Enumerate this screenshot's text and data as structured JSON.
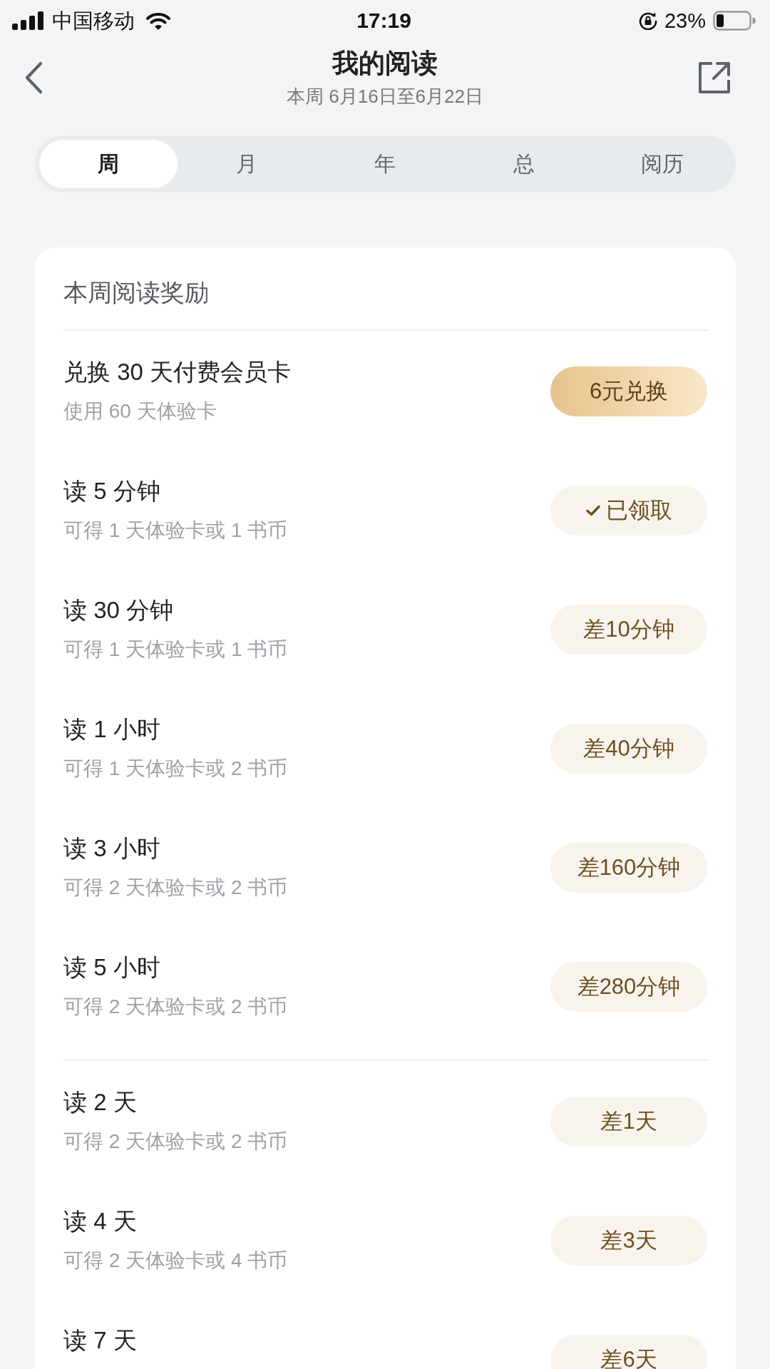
{
  "status_bar": {
    "carrier": "中国移动",
    "time": "17:19",
    "battery": "23%"
  },
  "header": {
    "title": "我的阅读",
    "subtitle": "本周 6月16日至6月22日"
  },
  "tabs": [
    {
      "label": "周",
      "selected": true
    },
    {
      "label": "月",
      "selected": false
    },
    {
      "label": "年",
      "selected": false
    },
    {
      "label": "总",
      "selected": false
    },
    {
      "label": "阅历",
      "selected": false
    }
  ],
  "rewards_card": {
    "title": "本周阅读奖励",
    "groups": [
      {
        "items": [
          {
            "title": "兑换 30 天付费会员卡",
            "subtitle": "使用 60 天体验卡",
            "action": {
              "kind": "exchange",
              "label": "6元兑换"
            }
          },
          {
            "title": "读 5 分钟",
            "subtitle": "可得 1 天体验卡或 1 书币",
            "action": {
              "kind": "claimed",
              "label": "已领取"
            }
          },
          {
            "title": "读 30 分钟",
            "subtitle": "可得 1 天体验卡或 1 书币",
            "action": {
              "kind": "remaining",
              "label": "差10分钟"
            }
          },
          {
            "title": "读 1 小时",
            "subtitle": "可得 1 天体验卡或 2 书币",
            "action": {
              "kind": "remaining",
              "label": "差40分钟"
            }
          },
          {
            "title": "读 3 小时",
            "subtitle": "可得 2 天体验卡或 2 书币",
            "action": {
              "kind": "remaining",
              "label": "差160分钟"
            }
          },
          {
            "title": "读 5 小时",
            "subtitle": "可得 2 天体验卡或 2 书币",
            "action": {
              "kind": "remaining",
              "label": "差280分钟"
            }
          }
        ]
      },
      {
        "items": [
          {
            "title": "读 2 天",
            "subtitle": "可得 2 天体验卡或 2 书币",
            "action": {
              "kind": "remaining",
              "label": "差1天"
            }
          },
          {
            "title": "读 4 天",
            "subtitle": "可得 2 天体验卡或 4 书币",
            "action": {
              "kind": "remaining",
              "label": "差3天"
            }
          },
          {
            "title": "读 7 天",
            "action": {
              "kind": "remaining",
              "label": "差6天"
            }
          }
        ]
      }
    ]
  }
}
